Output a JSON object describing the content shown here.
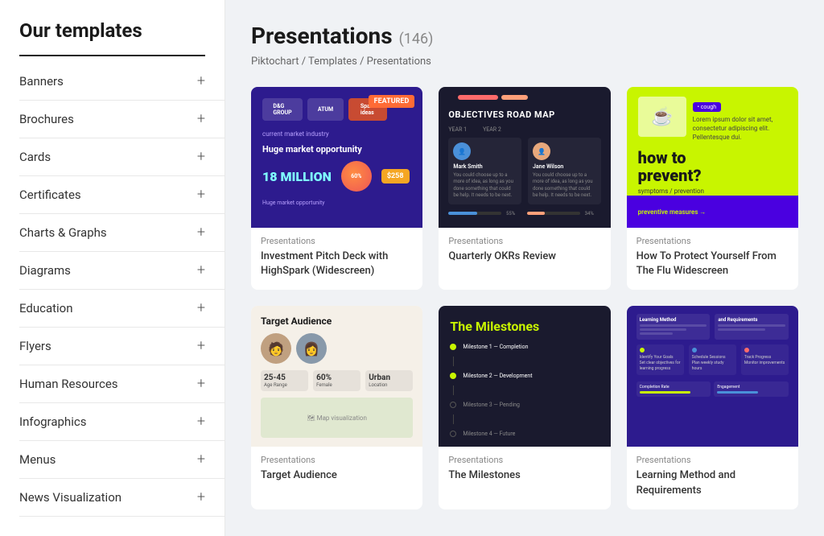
{
  "sidebar": {
    "title": "Our templates",
    "items": [
      {
        "id": "banners",
        "label": "Banners"
      },
      {
        "id": "brochures",
        "label": "Brochures"
      },
      {
        "id": "cards",
        "label": "Cards"
      },
      {
        "id": "certificates",
        "label": "Certificates"
      },
      {
        "id": "charts-graphs",
        "label": "Charts & Graphs"
      },
      {
        "id": "diagrams",
        "label": "Diagrams"
      },
      {
        "id": "education",
        "label": "Education"
      },
      {
        "id": "flyers",
        "label": "Flyers"
      },
      {
        "id": "human-resources",
        "label": "Human Resources"
      },
      {
        "id": "infographics",
        "label": "Infographics"
      },
      {
        "id": "menus",
        "label": "Menus"
      },
      {
        "id": "news-visualization",
        "label": "News Visualization"
      }
    ],
    "plus_icon": "+"
  },
  "main": {
    "page_title": "Presentations",
    "page_count": "(146)",
    "breadcrumb": "Piktochart / Templates / Presentations",
    "templates": [
      {
        "id": "t1",
        "category": "Presentations",
        "name": "Investment Pitch Deck with HighSpark (Widescreen)"
      },
      {
        "id": "t2",
        "category": "Presentations",
        "name": "Quarterly OKRs Review"
      },
      {
        "id": "t3",
        "category": "Presentations",
        "name": "How To Protect Yourself From The Flu Widescreen"
      },
      {
        "id": "t4",
        "category": "Presentations",
        "name": "Target Audience"
      },
      {
        "id": "t5",
        "category": "Presentations",
        "name": "The Milestones"
      },
      {
        "id": "t6",
        "category": "Presentations",
        "name": "Learning Method and Requirements"
      }
    ]
  },
  "icons": {
    "plus": "+",
    "slash": "/"
  }
}
